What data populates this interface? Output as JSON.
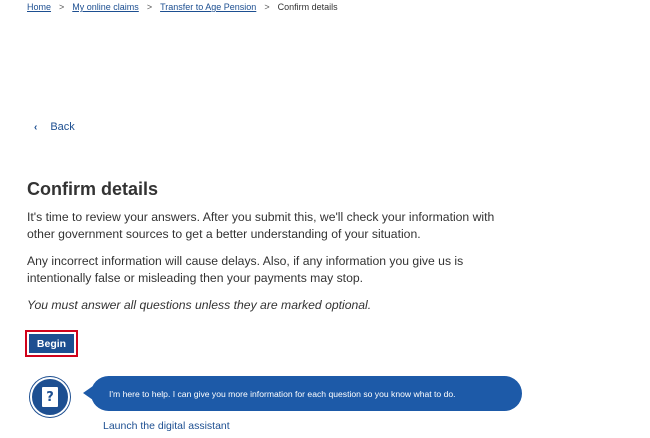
{
  "breadcrumb": {
    "items": [
      "Home",
      "My online claims",
      "Transfer to Age Pension"
    ],
    "current": "Confirm details",
    "separator": ">"
  },
  "back": {
    "icon": "chevron-left-icon",
    "label": "Back"
  },
  "page": {
    "title": "Confirm details",
    "paragraph1": "It's time to review your answers. After you submit this, we'll check your information with other government sources to get a better understanding of your situation.",
    "paragraph2": "Any incorrect information will cause delays. Also, if any information you give us is intentionally false or misleading then your payments may stop.",
    "paragraph3": "You must answer all questions unless they are marked optional."
  },
  "begin_button": {
    "label": "Begin"
  },
  "assistant": {
    "icon": "help-document-icon",
    "icon_glyph": "?",
    "message": "I'm here to help. I can give you more information for each question so you know what to do.",
    "launch_label": "Launch the digital assistant"
  },
  "colors": {
    "brand": "#1d4f91",
    "focus": "#d0021b",
    "bubble": "#1d5aa8"
  }
}
